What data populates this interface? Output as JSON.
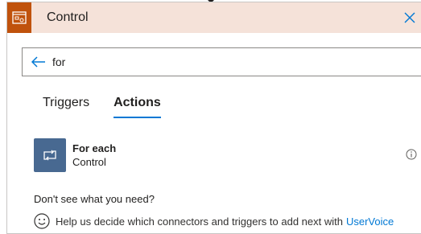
{
  "header": {
    "title": "Control",
    "icon": "control-icon",
    "close_icon": "close-icon"
  },
  "search": {
    "value": "for",
    "back_icon": "back-arrow-icon"
  },
  "tabs": [
    {
      "label": "Triggers",
      "active": false
    },
    {
      "label": "Actions",
      "active": true
    }
  ],
  "actions": [
    {
      "name": "For each",
      "connector": "Control",
      "icon": "loop-icon",
      "info_icon": "info-icon"
    }
  ],
  "footer": {
    "question": "Don't see what you need?",
    "help_text": "Help us decide which connectors and triggers to add next with",
    "link_text": "UserVoice",
    "icon": "smiley-icon"
  },
  "colors": {
    "header_bg": "#f5e2d9",
    "header_icon_bg": "#c0520c",
    "action_tile_bg": "#486991",
    "accent": "#0078d4"
  }
}
